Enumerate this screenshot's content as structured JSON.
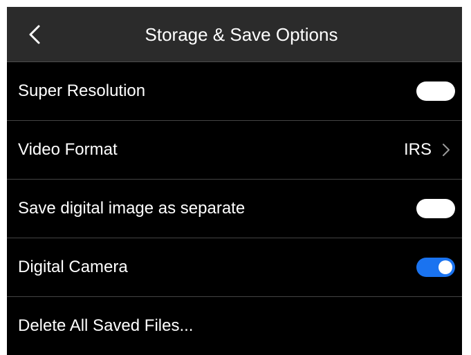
{
  "header": {
    "title": "Storage & Save Options",
    "back_icon": "chevron-left-icon"
  },
  "settings": [
    {
      "label": "Super Resolution",
      "control": "toggle",
      "state": "off"
    },
    {
      "label": "Video Format",
      "control": "value",
      "value": "IRS",
      "icon": "chevron-right-icon"
    },
    {
      "label": "Save digital image as separate",
      "control": "toggle",
      "state": "off"
    },
    {
      "label": "Digital Camera",
      "control": "toggle",
      "state": "on"
    },
    {
      "label": "Delete All Saved Files...",
      "control": "none"
    }
  ],
  "colors": {
    "header_bg": "#2b2b2b",
    "screen_bg": "#000000",
    "divider": "#444444",
    "toggle_on": "#1a73f0",
    "text": "#ffffff"
  }
}
